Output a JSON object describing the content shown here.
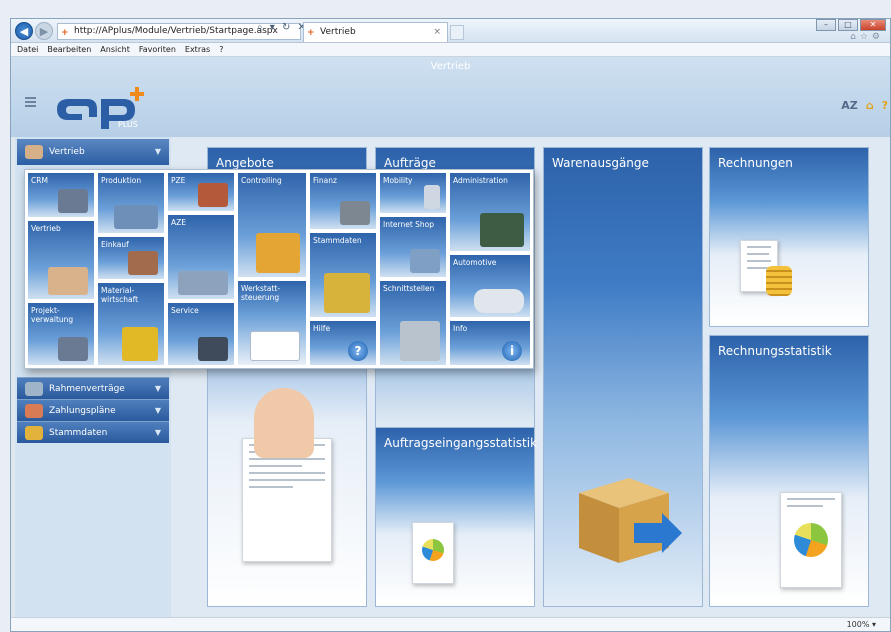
{
  "browser": {
    "url": "http://APplus/Module/Vertrieb/Startpage.aspx",
    "url_controls": "⌕ ▾ ↻ ✕",
    "tab_title": "Vertrieb",
    "tab_close": "×",
    "menu": [
      "Datei",
      "Bearbeiten",
      "Ansicht",
      "Favoriten",
      "Extras",
      "?"
    ],
    "zoom": "100%"
  },
  "app": {
    "title": "Vertrieb",
    "logo_text": "PLUS",
    "header_icons": [
      "AZ",
      "⌂",
      "?"
    ]
  },
  "nav": {
    "head_label": "Vertrieb",
    "items": [
      {
        "label": "Rahmenverträge",
        "icon": "contract-icon"
      },
      {
        "label": "Zahlungspläne",
        "icon": "calendar-icon"
      },
      {
        "label": "Stammdaten",
        "icon": "folder-icon"
      }
    ]
  },
  "popup_tiles": [
    {
      "label": "CRM",
      "icon": "people-icon",
      "color": "#6b7a93"
    },
    {
      "label": "Produktion",
      "icon": "factory-icon",
      "color": "#6d8fb8"
    },
    {
      "label": "PZE",
      "icon": "clock-people-icon",
      "color": "#b45a3a"
    },
    {
      "label": "Controlling",
      "icon": "chart-man-icon",
      "color": "#e4a534"
    },
    {
      "label": "Finanz",
      "icon": "safe-icon",
      "color": "#7d8791"
    },
    {
      "label": "Mobility",
      "icon": "phone-icon",
      "color": "#cfd8e2"
    },
    {
      "label": "Administration",
      "icon": "monitor-tools-icon",
      "color": "#3c5c43"
    },
    {
      "label": "Vertrieb",
      "icon": "handshake-icon",
      "color": "#d7b28a"
    },
    {
      "label": "Einkauf",
      "icon": "cart-icon",
      "color": "#a36b4e"
    },
    {
      "label": "AZE",
      "icon": "building-clock-icon",
      "color": "#8da2bd"
    },
    {
      "label": "Stammdaten",
      "icon": "folders-icon",
      "color": "#d8b33c"
    },
    {
      "label": "Internet Shop",
      "icon": "web-cart-icon",
      "color": "#7f9fc4"
    },
    {
      "label": "Automotive",
      "icon": "car-icon",
      "color": "#e1e6ec"
    },
    {
      "label": "Material-\nwirtschaft",
      "icon": "forklift-icon",
      "color": "#e1b826"
    },
    {
      "label": "Werkstatt-\nsteuerung",
      "icon": "gantt-icon",
      "color": "#ffffff"
    },
    {
      "label": "Schnittstellen",
      "icon": "database-icon",
      "color": "#b9c3cd"
    },
    {
      "label": "Projekt-\nverwaltung",
      "icon": "team-icon",
      "color": "#6b7a93"
    },
    {
      "label": "Service",
      "icon": "headset-icon",
      "color": "#3f4b5a"
    },
    {
      "label": "Hilfe",
      "icon": "help-icon",
      "color": "#1d5fae"
    },
    {
      "label": "Info",
      "icon": "info-icon",
      "color": "#1d5fae"
    }
  ],
  "tiles": [
    {
      "title": "Angebote"
    },
    {
      "title": "Aufträge"
    },
    {
      "title": "Warenausgänge"
    },
    {
      "title": "Rechnungen"
    },
    {
      "title": "Rechnungsstatistik"
    },
    {
      "title": "Auftragseingangsstatistik"
    }
  ],
  "colors": {
    "accent": "#2d62aa",
    "tile_top": "#2d62aa",
    "logo_plus": "#f08a1c",
    "box": "#d6a24a"
  }
}
